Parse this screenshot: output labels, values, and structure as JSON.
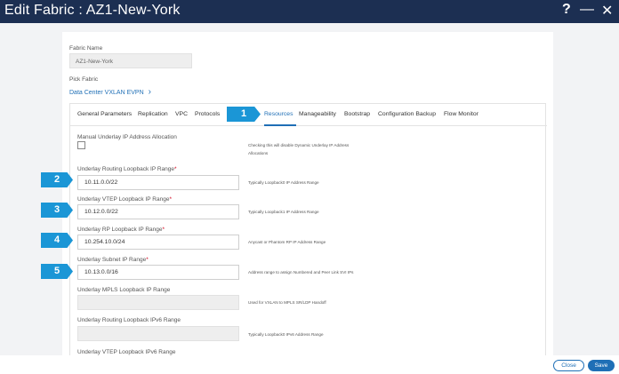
{
  "window": {
    "title": "Edit Fabric : AZ1-New-York",
    "help_icon": "?",
    "minimize_icon": "—",
    "close_icon": "✕"
  },
  "form": {
    "fabric_name_label": "Fabric Name",
    "fabric_name_value": "AZ1-New-York",
    "pick_fabric_label": "Pick Fabric",
    "pick_fabric_value": "Data Center VXLAN EVPN",
    "pick_fabric_chevron": "›"
  },
  "tabs": [
    {
      "label": "General Parameters"
    },
    {
      "label": "Replication"
    },
    {
      "label": "VPC"
    },
    {
      "label": "Protocols"
    },
    {
      "label": "Resources"
    },
    {
      "label": "Manageability"
    },
    {
      "label": "Bootstrap"
    },
    {
      "label": "Configuration Backup"
    },
    {
      "label": "Flow Monitor"
    }
  ],
  "active_tab": "Resources",
  "resources": {
    "manual_allocation": {
      "label": "Manual Underlay IP Address Allocation",
      "help_line1": "Checking this will disable Dynamic Underlay IP Address",
      "help_line2": "Allocations",
      "checked": false
    },
    "fields": [
      {
        "label": "Underlay Routing Loopback IP Range",
        "required": true,
        "value": "10.11.0.0/22",
        "help": "Typically Loopback0 IP Address Range"
      },
      {
        "label": "Underlay VTEP Loopback IP Range",
        "required": true,
        "value": "10.12.0.0/22",
        "help": "Typically Loopback1 IP Address Range"
      },
      {
        "label": "Underlay RP Loopback IP Range",
        "required": true,
        "value": "10.254.10.0/24",
        "help": "Anycast or Phantom RP IP Address Range"
      },
      {
        "label": "Underlay Subnet IP Range",
        "required": true,
        "value": "10.13.0.0/16",
        "help": "Address range to assign Numbered and Peer Link SVI IPs"
      },
      {
        "label": "Underlay MPLS Loopback IP Range",
        "required": false,
        "value": "",
        "help": "Used for VXLAN to MPLS SR/LDP Handoff"
      },
      {
        "label": "Underlay Routing Loopback IPv6 Range",
        "required": false,
        "value": "",
        "help": "Typically Loopback0 IPv6 Address Range"
      },
      {
        "label": "Underlay VTEP Loopback IPv6 Range",
        "required": false,
        "value": "",
        "help": ""
      }
    ],
    "required_marker": "*"
  },
  "callouts": [
    "1",
    "2",
    "3",
    "4",
    "5"
  ],
  "footer": {
    "close_label": "Close",
    "save_label": "Save"
  },
  "colors": {
    "titlebar": "#1c2f52",
    "accent": "#1f6fb6",
    "callout": "#1b96d6",
    "required": "#d0021b"
  }
}
